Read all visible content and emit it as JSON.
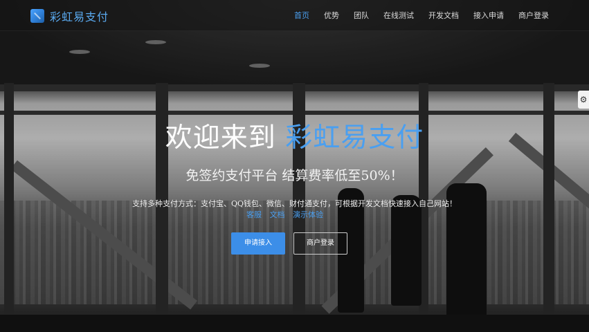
{
  "brand": {
    "name": "彩虹易支付",
    "icon": "logo-icon"
  },
  "nav": {
    "items": [
      {
        "label": "首页",
        "active": true
      },
      {
        "label": "优势"
      },
      {
        "label": "团队"
      },
      {
        "label": "在线测试"
      },
      {
        "label": "开发文档"
      },
      {
        "label": "接入申请"
      },
      {
        "label": "商户登录"
      }
    ]
  },
  "hero": {
    "title_prefix": "欢迎来到 ",
    "title_highlight": "彩虹易支付",
    "subtitle": "免签约支付平台 结算费率低至50%！",
    "description": "支持多种支付方式：支付宝、QQ钱包、微信、财付通支付，可根据开发文档快速接入自己网站！",
    "links": [
      "客服",
      "文档",
      "演示体验"
    ],
    "primary_button": "申请接入",
    "secondary_button": "商户登录"
  },
  "settings": {
    "icon": "gear-icon"
  },
  "colors": {
    "accent": "#4a9ff0",
    "button": "#3c8ee8"
  }
}
